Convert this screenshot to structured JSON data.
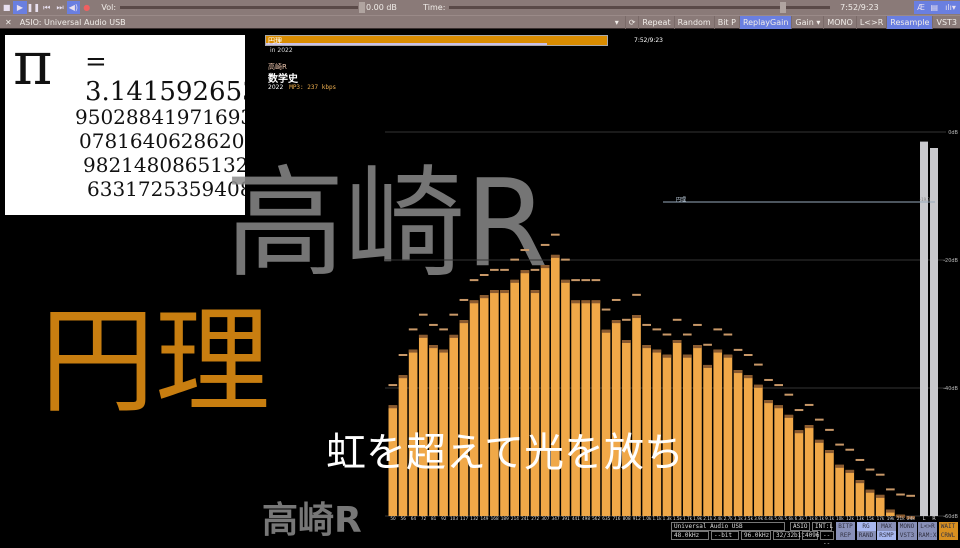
{
  "toolbar": {
    "vol_label": "Vol:",
    "vol_value": "0.00 dB",
    "time_label": "Time:",
    "time_value": "7:52/9:23",
    "volume_fraction": 0.98,
    "time_fraction": 0.838
  },
  "device": {
    "name": "ASIO: Universal Audio USB",
    "buttons": [
      "Repeat",
      "Random",
      "Bit P",
      "ReplayGain",
      "Gain ▾",
      "MONO",
      "L<>R",
      "Resample",
      "VST3"
    ],
    "active": [
      "ReplayGain",
      "Resample"
    ]
  },
  "track": {
    "title": "円理",
    "album_line": "in 2022",
    "time": "7:52/9:23",
    "progress": 0.825,
    "artist": "高崎R",
    "album": "数学史",
    "year": "2022",
    "format": "MP3: 237 kbps"
  },
  "art": {
    "pi": "π",
    "eq": "= 3.14159265358979",
    "rows": [
      "9502884197169399",
      "0781640628620899",
      "9821480865132823",
      "6331725359408128"
    ]
  },
  "background": {
    "artist_big": "高崎R",
    "title_big": "円理",
    "lyric": "虹を超えて光を放ち",
    "artist_small": "高崎R"
  },
  "marker": {
    "label": "円理",
    "right": "-19.3"
  },
  "chart_data": {
    "type": "bar",
    "title": "Spectrum",
    "ylabel": "dB",
    "ylim": [
      -60,
      0
    ],
    "yticks": [
      "0dB",
      "-20dB",
      "-40dB",
      "-60dB"
    ],
    "categories": [
      "50",
      "56",
      "64",
      "72",
      "81",
      "92",
      "103",
      "117",
      "132",
      "149",
      "168",
      "189",
      "214",
      "241",
      "272",
      "307",
      "347",
      "391",
      "441",
      "498",
      "562",
      "635",
      "716",
      "808",
      "912",
      "1.0k",
      "1.1k",
      "1.3k",
      "1.5k",
      "1.7k",
      "1.9k",
      "2.1k",
      "2.4k",
      "2.7k",
      "3.1k",
      "3.5k",
      "3.9k",
      "4.4k",
      "5.0k",
      "5.6k",
      "6.3k",
      "7.1k",
      "8.1k",
      "9.1k",
      "10k",
      "12k",
      "13k",
      "15k",
      "17k",
      "19k",
      "21k",
      "24k"
    ],
    "values": [
      -42.7,
      -38,
      -34,
      -31.7,
      -33.3,
      -34,
      -31.7,
      -29.4,
      -26.3,
      -25.5,
      -24.7,
      -24.7,
      -23.1,
      -21.6,
      -24.7,
      -20.8,
      -19.2,
      -23.1,
      -26.3,
      -26.3,
      -26.3,
      -30.9,
      -29.4,
      -32.5,
      -28.6,
      -33.3,
      -34,
      -34.8,
      -32.5,
      -34.8,
      -33.3,
      -36.4,
      -34,
      -34.8,
      -37.2,
      -38,
      -39.5,
      -41.9,
      -42.7,
      -44.2,
      -46.6,
      -45.8,
      -48.1,
      -49.7,
      -52,
      -52.8,
      -54.4,
      -55.9,
      -56.7,
      -59,
      -59.8,
      -60
    ],
    "meters": {
      "labels": [
        "L",
        "R"
      ],
      "values": [
        -1.5,
        -2.5
      ]
    }
  },
  "status": {
    "device": "Universal Audio USB",
    "driver": "ASIO",
    "int": "INT:L",
    "rate_in": "48.0kHz",
    "bits_in": "--bit",
    "rate_out": "96.0kHz",
    "bits_out": "32/32bit",
    "buffer": "4096",
    "extra": "----",
    "row1": [
      "BITP",
      "RG",
      "MAX",
      "MONO",
      "L<>R",
      "WAIT"
    ],
    "row2": [
      "REP",
      "RAND",
      "RSMP",
      "VST3",
      "RAM:X",
      "CRWL"
    ]
  },
  "colors": {
    "accent": "#6a7fe0",
    "bar": "#f0a848",
    "title_bar": "#d98c00"
  }
}
